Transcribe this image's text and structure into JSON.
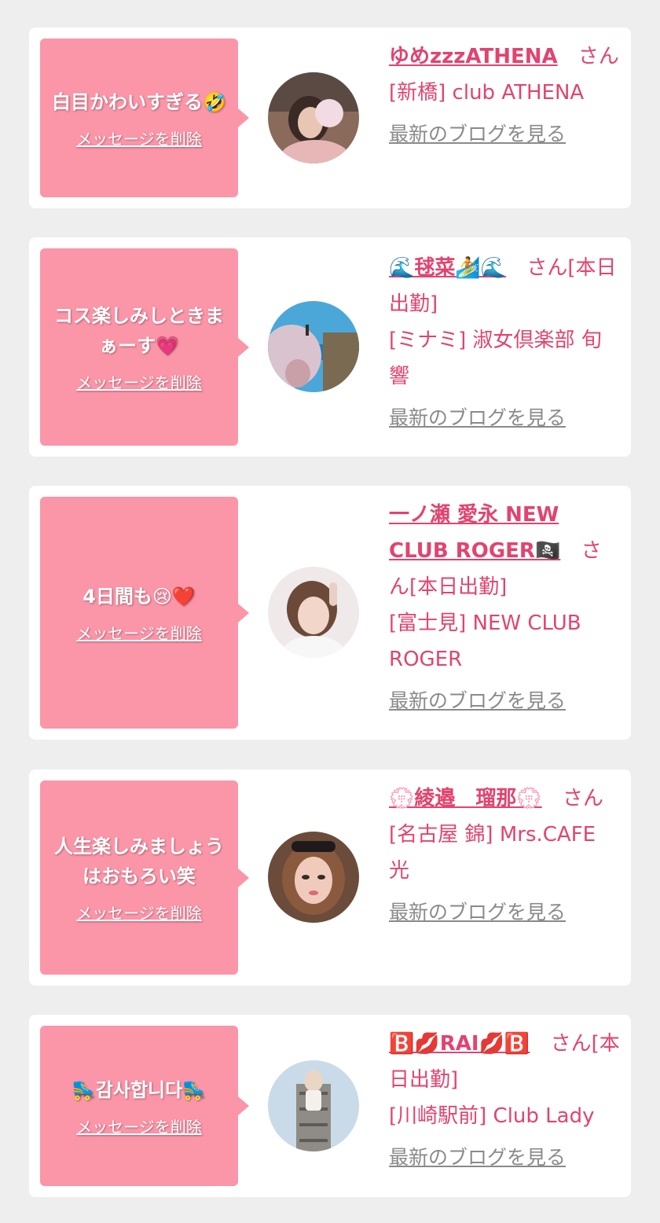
{
  "delete_label": "メッセージを削除",
  "blog_label": "最新のブログを見る",
  "colors": {
    "bubble": "#fb95a8",
    "name": "#e1446f",
    "blog": "#8a8a8a",
    "background": "#eeeeee"
  },
  "cards": [
    {
      "message": "白目かわいすぎる🤣",
      "name": "ゆめzzzATHENA",
      "suffix": "さん",
      "area": "[新橋] club ATHENA"
    },
    {
      "message": "コス楽しみしときまぁーす💗",
      "name": "🌊毬菜🏄🌊",
      "suffix": "さん[本日出勤]",
      "area": "[ミナミ] 淑女倶楽部 旬響"
    },
    {
      "message": "4日間も😢❤️",
      "name": "一ノ瀬 愛永 NEW CLUB ROGER🏴‍☠️",
      "suffix": "さん[本日出勤]",
      "area": "[富士見] NEW CLUB ROGER"
    },
    {
      "message": "人生楽しみましょうはおもろい笑",
      "name": "💮綾邉　瑠那💮",
      "suffix": "さん",
      "area": "[名古屋 錦] Mrs.CAFE 光"
    },
    {
      "message": "🛼감사합니다🛼",
      "name": "🅱️💋RAI💋🅱️",
      "suffix": "さん[本日出勤]",
      "area": "[川崎駅前] Club Lady"
    }
  ]
}
